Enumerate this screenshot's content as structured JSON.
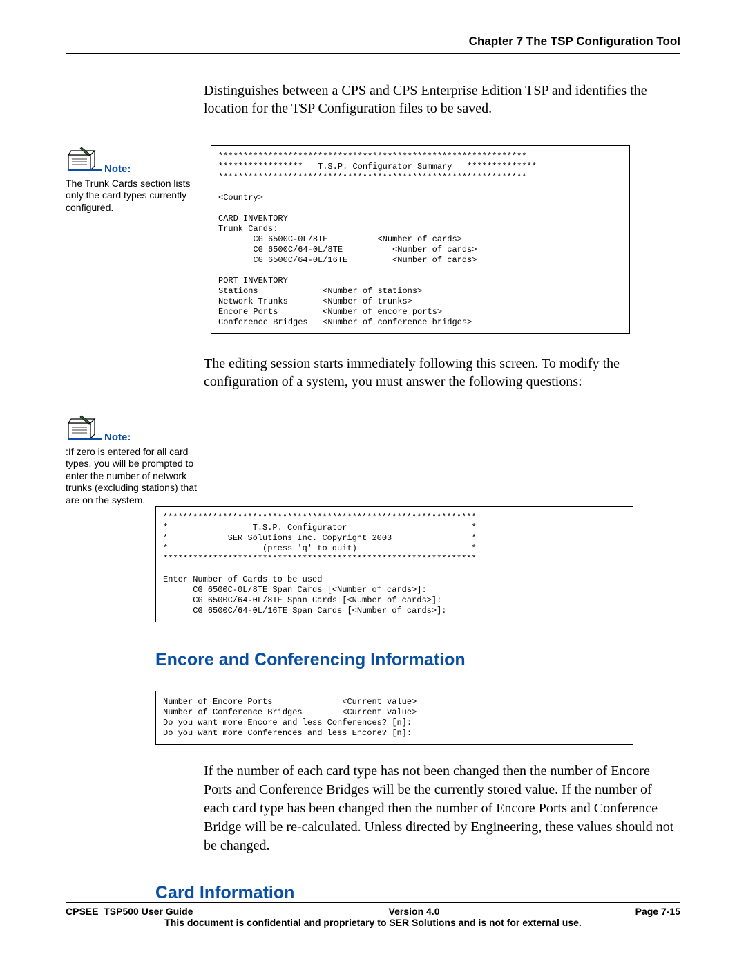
{
  "header": {
    "chapter": "Chapter 7 The TSP Configuration Tool"
  },
  "intro": "Distinguishes between a CPS and CPS Enterprise Edition TSP and identifies the location for the TSP Configuration files to be saved.",
  "note1": {
    "label": "Note:",
    "text": "The Trunk Cards section lists only the card types currently configured."
  },
  "note2": {
    "label": "Note:",
    "text": ":If zero is entered for all card types, you will be prompted to enter the number of network trunks (excluding stations) that are on the system."
  },
  "console_summary": "**************************************************************\n*****************   T.S.P. Configurator Summary   **************\n**************************************************************\n\n<Country>\n\nCARD INVENTORY\nTrunk Cards:\n       CG 6500C-0L/8TE          <Number of cards>\n       CG 6500C/64-0L/8TE          <Number of cards>\n       CG 6500C/64-0L/16TE         <Number of cards>\n\nPORT INVENTORY\nStations             <Number of stations>\nNetwork Trunks       <Number of trunks>\nEncore Ports         <Number of encore ports>\nConference Bridges   <Number of conference bridges>",
  "editing_para": "The editing session starts immediately following this screen. To modify the configuration of a system, you must answer the following questions:",
  "console_configurator": "***************************************************************\n*                 T.S.P. Configurator                         *\n*            SER Solutions Inc. Copyright 2003                *\n*                   (press 'q' to quit)                       *\n***************************************************************\n\nEnter Number of Cards to be used\n      CG 6500C-0L/8TE Span Cards [<Number of cards>]:\n      CG 6500C/64-0L/8TE Span Cards [<Number of cards>]:\n      CG 6500C/64-0L/16TE Span Cards [<Number of cards>]:",
  "section1": "Encore and Conferencing Information",
  "console_encore": "Number of Encore Ports              <Current value>\nNumber of Conference Bridges        <Current value>\nDo you want more Encore and less Conferences? [n]:\nDo you want more Conferences and less Encore? [n]:",
  "encore_para": "If the number of each card type has not been changed then the number of Encore Ports and Conference Bridges will be the currently stored value.  If the number of each card type has been changed then the number of Encore Ports and Conference Bridge will be re-calculated.  Unless directed by Engineering, these values should not be changed.",
  "section2": "Card Information",
  "footer": {
    "left": "CPSEE_TSP500 User Guide",
    "center": "Version 4.0",
    "right": "Page 7-15",
    "notice": "This document is confidential and proprietary to SER Solutions and is not for external use."
  }
}
